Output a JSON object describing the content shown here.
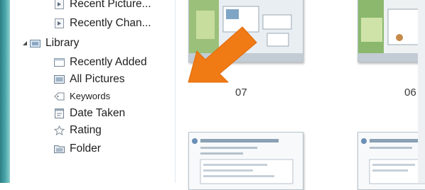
{
  "tree": {
    "items": [
      {
        "label": "Recent Picture...",
        "icon": "arrow-page-icon"
      },
      {
        "label": "Recently Chan...",
        "icon": "arrow-page-icon"
      },
      {
        "label": "Library",
        "icon": "library-icon"
      },
      {
        "label": "Recently Added",
        "icon": "folder-window-icon"
      },
      {
        "label": "All Pictures",
        "icon": "pictures-icon"
      },
      {
        "label": "Keywords",
        "icon": "tag-icon"
      },
      {
        "label": "Date Taken",
        "icon": "calendar-icon"
      },
      {
        "label": "Rating",
        "icon": "star-icon"
      },
      {
        "label": "Folder",
        "icon": "folder-icon"
      }
    ]
  },
  "gallery": {
    "captions": [
      "07",
      "06"
    ]
  },
  "colors": {
    "accent_arrow": "#f07a14",
    "side_strip": "#3d9aa0"
  }
}
